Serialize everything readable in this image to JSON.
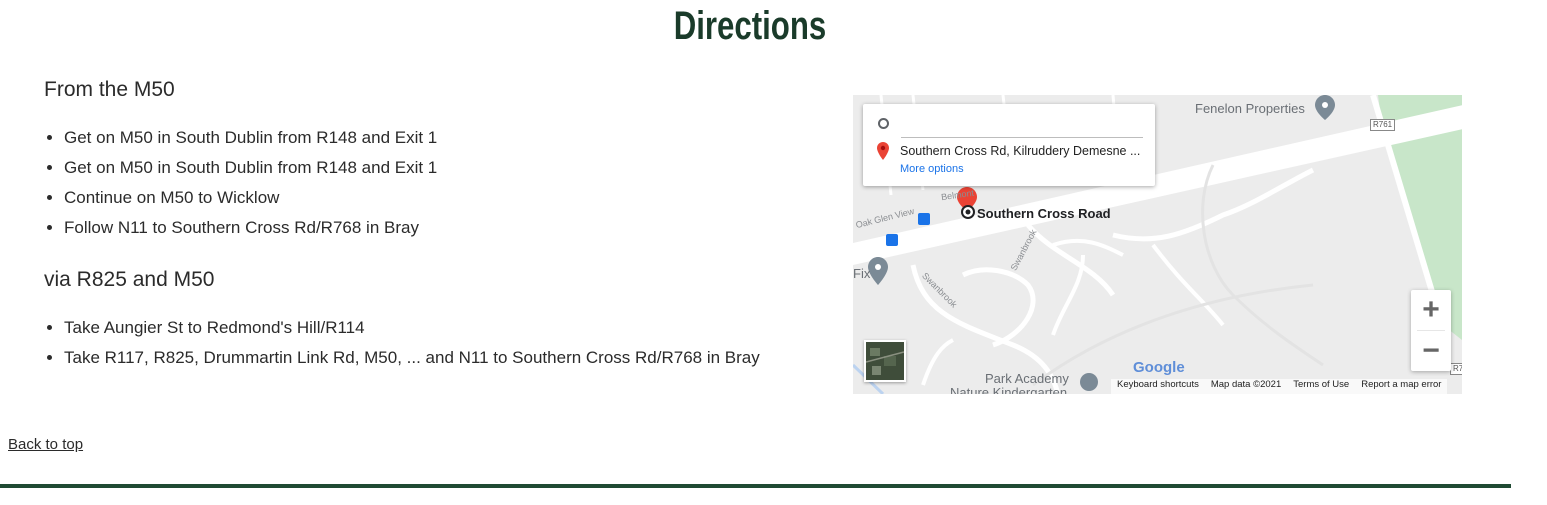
{
  "page": {
    "title": "Directions",
    "back_to_top": "Back to top"
  },
  "sections": [
    {
      "heading": "From the M50",
      "steps": [
        "Get on M50 in South Dublin from R148 and Exit 1",
        "Get on M50 in South Dublin from R148 and Exit 1",
        "Continue on M50 to Wicklow",
        "Follow N11 to Southern Cross Rd/R768 in Bray"
      ]
    },
    {
      "heading": "via R825 and M50",
      "steps": [
        "Take Aungier St to Redmond's Hill/R114",
        "Take R117, R825, Drummartin Link Rd, M50, ... and N11 to Southern Cross Rd/R768 in Bray"
      ]
    }
  ],
  "map": {
    "destination": "Southern Cross Rd, Kilruddery Demesne ...",
    "more_options": "More options",
    "marker_label": "Southern Cross Road",
    "places": {
      "fenelon": "Fenelon Properties",
      "park_academy": "Park Academy",
      "nature_kindergarten": "Nature Kindergarten",
      "fix": "Fix"
    },
    "roads": {
      "oak_glen": "Oak Glen View",
      "swanbrook_1": "Swanbrook",
      "swanbrook_2": "Swanbrook",
      "belmont": "Belmont",
      "r761": "R761",
      "r7": "R7"
    },
    "zoom_in": "+",
    "zoom_out": "−",
    "logo": "Google",
    "footer": {
      "shortcuts": "Keyboard shortcuts",
      "map_data": "Map data ©2021",
      "terms": "Terms of Use",
      "report": "Report a map error"
    },
    "colors": {
      "park": "#c8e6c9",
      "road": "#ffffff",
      "pin": "#ea4335",
      "link": "#1a73e8"
    }
  }
}
